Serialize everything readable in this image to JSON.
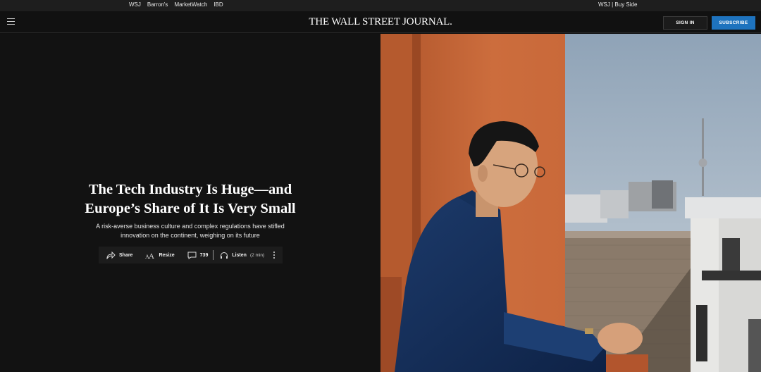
{
  "topbar": {
    "brands": [
      "WSJ",
      "Barron's",
      "MarketWatch",
      "IBD"
    ],
    "right_link": "WSJ | Buy Side"
  },
  "masthead": {
    "logo": "THE WALL STREET JOURNAL.",
    "signin_label": "SIGN IN",
    "subscribe_label": "SUBSCRIBE"
  },
  "article": {
    "headline_line1": "The Tech Industry Is Huge—and",
    "headline_line2": "Europe’s Share of It Is Very Small",
    "dek_line1": "A risk-averse business culture and complex regulations have stifled",
    "dek_line2": "innovation on the continent, weighing on its future",
    "toolbar": {
      "share_label": "Share",
      "resize_label": "Resize",
      "comments_count": "739",
      "listen_label": "Listen",
      "listen_duration": "(2 min)"
    }
  },
  "colors": {
    "background": "#111111",
    "subscribe_blue": "#1e73be",
    "wall_orange": "#c8693a"
  },
  "icons": [
    "menu-icon",
    "share-icon",
    "resize-icon",
    "comment-icon",
    "headphones-icon",
    "more-icon"
  ]
}
